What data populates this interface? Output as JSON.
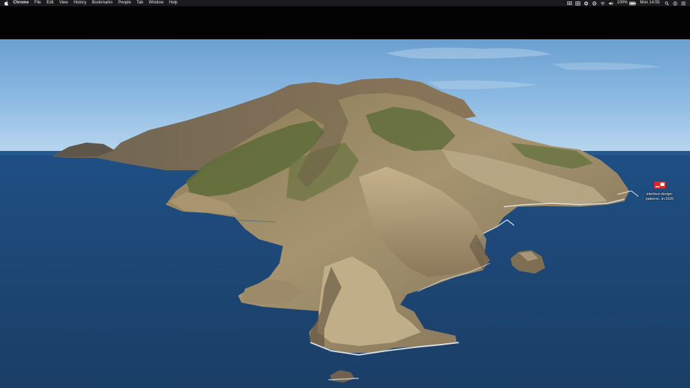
{
  "menubar": {
    "items": [
      "Chrome",
      "File",
      "Edit",
      "View",
      "History",
      "Bookmarks",
      "People",
      "Tab",
      "Window",
      "Help"
    ],
    "status": {
      "icons": [
        "display-icon",
        "grid-icon",
        "stop-icon",
        "globe-icon",
        "wifi-icon",
        "volume-icon"
      ],
      "battery": "100%",
      "battery_icon": "battery-icon",
      "clock": "Mon 14:55",
      "trailing_icons": [
        "search-icon",
        "user-icon",
        "control-center-icon"
      ]
    }
  },
  "desktop": {
    "file": {
      "name_line1": "interface-design-",
      "name_line2": "patterns...in-2020",
      "icon": "pdf-document-icon",
      "color": "#d8262b"
    }
  },
  "colors": {
    "menubar_bg": "#1b1b1d",
    "band_bg": "#030303",
    "sky_top": "#6a9fd0",
    "sea": "#1f4a77"
  }
}
